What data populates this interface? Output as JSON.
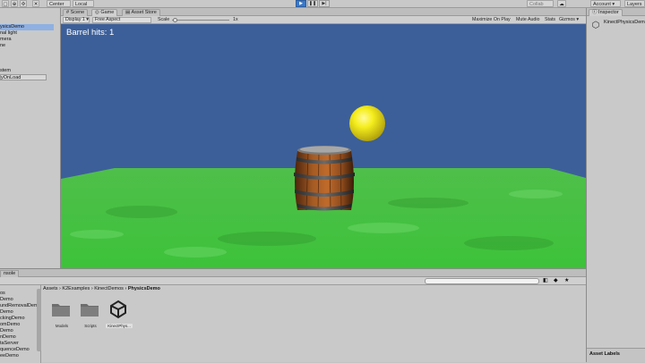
{
  "toolbar": {
    "pivot_label": "Center",
    "space_label": "Local",
    "collab_label": "Collab",
    "account_label": "Account",
    "layers_label": "Layers"
  },
  "hierarchy": {
    "items": [
      {
        "label": "ysicsDemo",
        "selected": true
      },
      {
        "label": "nal light",
        "selected": false
      },
      {
        "label": "mera",
        "selected": false
      },
      {
        "label": "ne",
        "selected": false
      },
      {
        "label": "stem",
        "selected": false
      },
      {
        "label": "yOnLoad",
        "selected": false
      }
    ]
  },
  "tabs": {
    "scene": "Scene",
    "game": "Game",
    "asset_store": "Asset Store"
  },
  "game_toolbar": {
    "display": "Display 1",
    "aspect": "Free Aspect",
    "scale_label": "Scale",
    "scale_value": "1x",
    "maximize": "Maximize On Play",
    "mute": "Mute Audio",
    "stats": "Stats",
    "gizmos": "Gizmos"
  },
  "game_view": {
    "barrel_hits": "Barrel hits: 1",
    "sky_color": "#3c5f99",
    "ground_color": "#49c447",
    "ball_color": "#f2ea1c"
  },
  "inspector": {
    "tab_label": "Inspector",
    "object_name": "KinectPhysicsDem",
    "asset_labels": "Asset Labels"
  },
  "project": {
    "tab_label": "nsole",
    "breadcrumb": [
      "Assets",
      "K2Examples",
      "KinectDemos",
      "PhysicsDemo"
    ],
    "tree": [
      "os",
      "Demo",
      "undRemovalDemo",
      "Demo",
      "ckingDemo",
      "omDemo",
      "Demo",
      "nDemo",
      "taServer",
      "quenceDemo",
      "eeDemo"
    ],
    "assets": [
      {
        "label": "Models",
        "type": "folder"
      },
      {
        "label": "Scripts",
        "type": "folder"
      },
      {
        "label": "KinectPhys...",
        "type": "unity"
      }
    ]
  }
}
